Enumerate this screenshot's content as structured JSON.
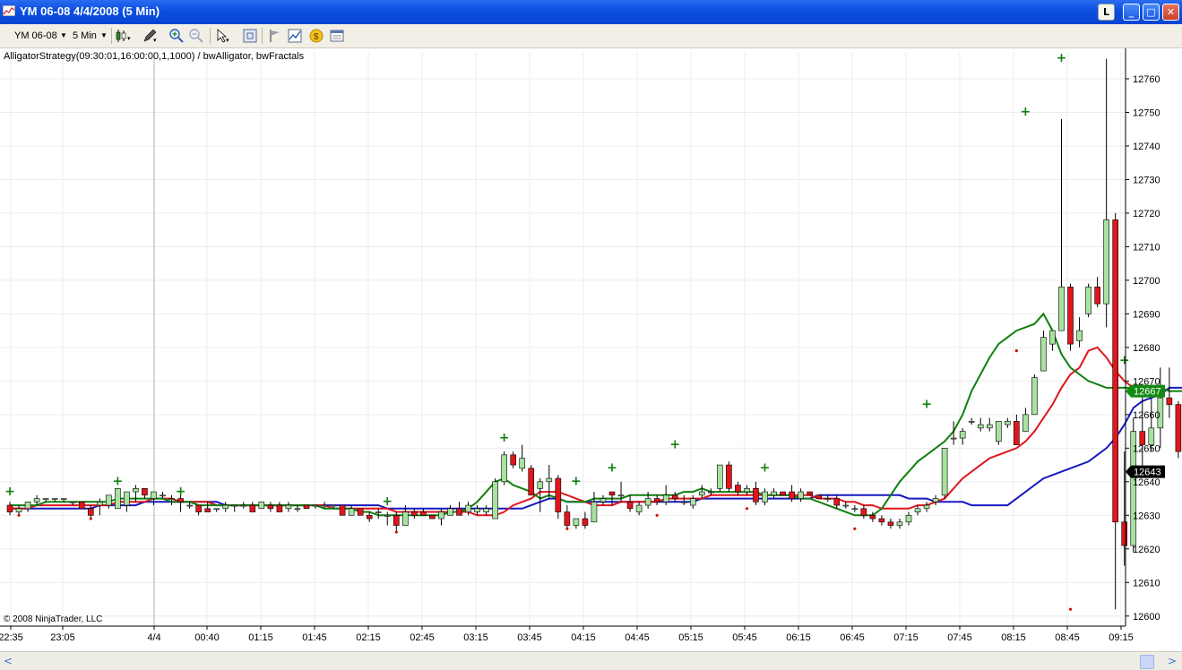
{
  "window": {
    "title": "YM 06-08  4/4/2008 (5 Min)",
    "buttons": {
      "light": "L",
      "minimize": "_",
      "maximize": "□",
      "close": "✕"
    }
  },
  "toolbar": {
    "instrument": "YM 06-08",
    "interval": "5 Min",
    "icons": [
      "candlestick-icon",
      "pencil-icon",
      "zoom-in-icon",
      "zoom-out-icon",
      "cursor-icon",
      "crosshair-icon",
      "flag-icon",
      "chart-icon",
      "strategy-icon",
      "data-box-icon"
    ]
  },
  "chart": {
    "strategy_label": "AlligatorStrategy(09:30:01,16:00:00,1,1000) / bwAlligator, bwFractals",
    "copyright": "© 2008 NinjaTrader, LLC",
    "last_price_label": "12643",
    "indicator_price_label": "12667",
    "colors": {
      "up": "#a8e2a0",
      "down": "#e0161c",
      "jaw": "#1818c0",
      "teeth": "#e0161c",
      "lips": "#108010",
      "fractal_up": "#108010",
      "fractal_down": "#d01010",
      "last_label_bg": "#000000",
      "ind_label_bg": "#128a12"
    }
  },
  "chart_data": {
    "type": "candlestick",
    "ylim": [
      12597,
      12768
    ],
    "y_ticks": [
      12600,
      12610,
      12620,
      12630,
      12640,
      12650,
      12660,
      12670,
      12680,
      12690,
      12700,
      12710,
      12720,
      12730,
      12740,
      12750,
      12760
    ],
    "x_labels": [
      "22:35",
      "23:05",
      "4/4",
      "00:40",
      "01:15",
      "01:45",
      "02:15",
      "02:45",
      "03:15",
      "03:45",
      "04:15",
      "04:45",
      "05:15",
      "05:45",
      "06:15",
      "06:45",
      "07:15",
      "07:45",
      "08:15",
      "08:45",
      "09:15"
    ],
    "candles": [
      [
        12633,
        12634,
        12630,
        12631
      ],
      [
        12631,
        12633,
        12630,
        12632
      ],
      [
        12632,
        12634,
        12631,
        12634
      ],
      [
        12634,
        12636,
        12633,
        12635
      ],
      [
        12635,
        12635,
        12634,
        12635
      ],
      [
        12635,
        12635,
        12634,
        12635
      ],
      [
        12635,
        12635,
        12634,
        12635
      ],
      [
        12634,
        12634,
        12633,
        12634
      ],
      [
        12634,
        12634,
        12632,
        12632
      ],
      [
        12632,
        12633,
        12629,
        12630
      ],
      [
        12633,
        12635,
        12630,
        12634
      ],
      [
        12633,
        12636,
        12632,
        12636
      ],
      [
        12632,
        12638,
        12632,
        12638
      ],
      [
        12633,
        12635,
        12631,
        12637
      ],
      [
        12637,
        12639,
        12634,
        12638
      ],
      [
        12638,
        12638,
        12635,
        12636
      ],
      [
        12635,
        12637,
        12633,
        12637
      ],
      [
        12636,
        12637,
        12635,
        12636
      ],
      [
        12635,
        12636,
        12633,
        12635
      ],
      [
        12635,
        12636,
        12631,
        12634
      ],
      [
        12633,
        12634,
        12632,
        12633
      ],
      [
        12633,
        12633,
        12630,
        12631
      ],
      [
        12632,
        12634,
        12631,
        12631
      ],
      [
        12632,
        12632,
        12631,
        12632
      ],
      [
        12632,
        12634,
        12631,
        12633
      ],
      [
        12633,
        12633,
        12631,
        12633
      ],
      [
        12633,
        12634,
        12632,
        12633
      ],
      [
        12633,
        12634,
        12631,
        12631
      ],
      [
        12632,
        12634,
        12632,
        12634
      ],
      [
        12633,
        12634,
        12631,
        12632
      ],
      [
        12633,
        12634,
        12631,
        12631
      ],
      [
        12632,
        12634,
        12631,
        12633
      ],
      [
        12632,
        12633,
        12631,
        12632
      ],
      [
        12633,
        12633,
        12632,
        12632
      ],
      [
        12633,
        12633,
        12632,
        12633
      ],
      [
        12633,
        12634,
        12632,
        12633
      ],
      [
        12633,
        12633,
        12632,
        12633
      ],
      [
        12633,
        12633,
        12630,
        12630
      ],
      [
        12630,
        12633,
        12630,
        12632
      ],
      [
        12632,
        12632,
        12630,
        12630
      ],
      [
        12630,
        12631,
        12628,
        12629
      ],
      [
        12631,
        12632,
        12629,
        12631
      ],
      [
        12630,
        12631,
        12627,
        12630
      ],
      [
        12630,
        12631,
        12625,
        12627
      ],
      [
        12627,
        12633,
        12627,
        12631
      ],
      [
        12631,
        12632,
        12629,
        12630
      ],
      [
        12631,
        12632,
        12630,
        12630
      ],
      [
        12630,
        12630,
        12629,
        12629
      ],
      [
        12629,
        12632,
        12627,
        12631
      ],
      [
        12630,
        12633,
        12630,
        12632
      ],
      [
        12632,
        12634,
        12630,
        12630
      ],
      [
        12631,
        12634,
        12630,
        12633
      ],
      [
        12631,
        12633,
        12630,
        12632
      ],
      [
        12631,
        12633,
        12630,
        12632
      ],
      [
        12629,
        12641,
        12629,
        12640
      ],
      [
        12640,
        12649,
        12639,
        12648
      ],
      [
        12648,
        12649,
        12644,
        12645
      ],
      [
        12644,
        12651,
        12643,
        12647
      ],
      [
        12644,
        12645,
        12636,
        12636
      ],
      [
        12638,
        12641,
        12631,
        12640
      ],
      [
        12640,
        12645,
        12635,
        12641
      ],
      [
        12641,
        12642,
        12629,
        12631
      ],
      [
        12631,
        12633,
        12626,
        12627
      ],
      [
        12627,
        12629,
        12626,
        12629
      ],
      [
        12629,
        12631,
        12626,
        12627
      ],
      [
        12628,
        12637,
        12628,
        12634
      ],
      [
        12634,
        12636,
        12633,
        12635
      ],
      [
        12637,
        12637,
        12633,
        12636
      ],
      [
        12636,
        12640,
        12634,
        12636
      ],
      [
        12634,
        12636,
        12631,
        12632
      ],
      [
        12631,
        12634,
        12630,
        12633
      ],
      [
        12633,
        12637,
        12632,
        12635
      ],
      [
        12635,
        12636,
        12633,
        12634
      ],
      [
        12634,
        12639,
        12633,
        12636
      ],
      [
        12636,
        12637,
        12634,
        12635
      ],
      [
        12634,
        12636,
        12633,
        12634
      ],
      [
        12633,
        12636,
        12632,
        12635
      ],
      [
        12636,
        12639,
        12635,
        12637
      ],
      [
        12637,
        12638,
        12636,
        12637
      ],
      [
        12638,
        12645,
        12637,
        12645
      ],
      [
        12645,
        12646,
        12637,
        12638
      ],
      [
        12639,
        12640,
        12636,
        12637
      ],
      [
        12637,
        12639,
        12636,
        12638
      ],
      [
        12638,
        12640,
        12633,
        12634
      ],
      [
        12634,
        12638,
        12633,
        12637
      ],
      [
        12636,
        12638,
        12635,
        12637
      ],
      [
        12637,
        12637,
        12636,
        12636
      ],
      [
        12637,
        12639,
        12634,
        12635
      ],
      [
        12635,
        12638,
        12634,
        12637
      ],
      [
        12637,
        12637,
        12636,
        12636
      ],
      [
        12636,
        12636,
        12635,
        12635
      ],
      [
        12635,
        12636,
        12634,
        12635
      ],
      [
        12635,
        12636,
        12632,
        12633
      ],
      [
        12633,
        12634,
        12632,
        12633
      ],
      [
        12632,
        12633,
        12631,
        12632
      ],
      [
        12632,
        12633,
        12629,
        12630
      ],
      [
        12630,
        12631,
        12628,
        12629
      ],
      [
        12629,
        12630,
        12627,
        12628
      ],
      [
        12628,
        12629,
        12626,
        12627
      ],
      [
        12627,
        12629,
        12626,
        12628
      ],
      [
        12628,
        12631,
        12627,
        12630
      ],
      [
        12631,
        12633,
        12630,
        12632
      ],
      [
        12632,
        12634,
        12631,
        12633
      ],
      [
        12634,
        12636,
        12633,
        12635
      ],
      [
        12636,
        12650,
        12635,
        12650
      ],
      [
        12653,
        12658,
        12651,
        12653
      ],
      [
        12653,
        12656,
        12651,
        12655
      ],
      [
        12658,
        12659,
        12657,
        12658
      ],
      [
        12656,
        12659,
        12655,
        12657
      ],
      [
        12656,
        12659,
        12655,
        12657
      ],
      [
        12652,
        12658,
        12651,
        12658
      ],
      [
        12657,
        12659,
        12656,
        12658
      ],
      [
        12658,
        12660,
        12651,
        12651
      ],
      [
        12655,
        12662,
        12655,
        12660
      ],
      [
        12660,
        12672,
        12660,
        12671
      ],
      [
        12673,
        12685,
        12673,
        12683
      ],
      [
        12681,
        12685,
        12679,
        12685
      ],
      [
        12685,
        12748,
        12685,
        12698
      ],
      [
        12698,
        12699,
        12679,
        12681
      ],
      [
        12682,
        12689,
        12680,
        12685
      ],
      [
        12690,
        12699,
        12689,
        12698
      ],
      [
        12698,
        12701,
        12692,
        12693
      ],
      [
        12693,
        12766,
        12686,
        12718
      ],
      [
        12718,
        12720,
        12602,
        12628
      ],
      [
        12628,
        12649,
        12615,
        12621
      ],
      [
        12621,
        12659,
        12619,
        12655
      ],
      [
        12655,
        12667,
        12644,
        12651
      ],
      [
        12651,
        12665,
        12649,
        12656
      ],
      [
        12656,
        12674,
        12650,
        12665
      ],
      [
        12665,
        12674,
        12659,
        12663
      ],
      [
        12663,
        12664,
        12647,
        12649
      ],
      [
        12649,
        12653,
        12641,
        12643
      ],
      [
        12641,
        12644,
        12640,
        12643
      ]
    ],
    "jaw": [
      12632,
      12632,
      12632,
      12632,
      12632,
      12632,
      12632,
      12632,
      12632,
      12632,
      12633,
      12633,
      12633,
      12633,
      12633,
      12634,
      12634,
      12634,
      12634,
      12634,
      12634,
      12634,
      12634,
      12634,
      12633,
      12633,
      12633,
      12633,
      12633,
      12633,
      12633,
      12633,
      12633,
      12633,
      12633,
      12633,
      12633,
      12633,
      12633,
      12633,
      12633,
      12633,
      12632,
      12632,
      12632,
      12632,
      12632,
      12632,
      12632,
      12632,
      12632,
      12632,
      12632,
      12632,
      12632,
      12632,
      12632,
      12632,
      12633,
      12634,
      12635,
      12635,
      12634,
      12634,
      12634,
      12634,
      12634,
      12634,
      12634,
      12634,
      12634,
      12634,
      12634,
      12634,
      12634,
      12634,
      12634,
      12635,
      12635,
      12635,
      12635,
      12635,
      12635,
      12635,
      12635,
      12635,
      12635,
      12635,
      12635,
      12635,
      12636,
      12636,
      12636,
      12636,
      12636,
      12636,
      12636,
      12636,
      12636,
      12636,
      12635,
      12635,
      12635,
      12634,
      12634,
      12634,
      12634,
      12633,
      12633,
      12633,
      12633,
      12633,
      12635,
      12637,
      12639,
      12641,
      12642,
      12643,
      12644,
      12645,
      12646,
      12648,
      12650,
      12653,
      12657,
      12662,
      12664,
      12665,
      12666,
      12668,
      12668,
      12668
    ],
    "teeth": [
      12632,
      12632,
      12632,
      12633,
      12633,
      12633,
      12633,
      12633,
      12633,
      12633,
      12633,
      12633,
      12634,
      12634,
      12634,
      12634,
      12635,
      12635,
      12635,
      12634,
      12634,
      12634,
      12634,
      12633,
      12633,
      12633,
      12633,
      12633,
      12633,
      12633,
      12633,
      12633,
      12633,
      12633,
      12633,
      12633,
      12632,
      12632,
      12632,
      12632,
      12632,
      12632,
      12632,
      12631,
      12631,
      12631,
      12631,
      12631,
      12631,
      12631,
      12631,
      12631,
      12630,
      12630,
      12630,
      12631,
      12633,
      12634,
      12635,
      12637,
      12637,
      12637,
      12636,
      12635,
      12634,
      12633,
      12633,
      12633,
      12634,
      12634,
      12634,
      12634,
      12634,
      12635,
      12635,
      12635,
      12635,
      12635,
      12636,
      12636,
      12636,
      12636,
      12636,
      12636,
      12636,
      12636,
      12636,
      12636,
      12636,
      12636,
      12635,
      12635,
      12635,
      12634,
      12634,
      12633,
      12633,
      12632,
      12632,
      12632,
      12632,
      12633,
      12633,
      12634,
      12635,
      12638,
      12641,
      12643,
      12645,
      12647,
      12648,
      12649,
      12650,
      12652,
      12655,
      12659,
      12663,
      12668,
      12672,
      12674,
      12679,
      12680,
      12677,
      12673,
      12670,
      12668,
      12668,
      12667
    ],
    "lips": [
      12633,
      12633,
      12633,
      12633,
      12634,
      12634,
      12634,
      12634,
      12634,
      12634,
      12634,
      12634,
      12635,
      12635,
      12635,
      12635,
      12635,
      12635,
      12634,
      12634,
      12634,
      12633,
      12633,
      12633,
      12633,
      12633,
      12633,
      12633,
      12633,
      12633,
      12633,
      12633,
      12633,
      12633,
      12633,
      12632,
      12632,
      12632,
      12632,
      12631,
      12631,
      12630,
      12630,
      12630,
      12630,
      12630,
      12630,
      12630,
      12630,
      12631,
      12631,
      12632,
      12634,
      12637,
      12640,
      12641,
      12639,
      12638,
      12637,
      12635,
      12636,
      12635,
      12634,
      12634,
      12634,
      12635,
      12635,
      12635,
      12635,
      12636,
      12636,
      12636,
      12636,
      12636,
      12636,
      12637,
      12637,
      12638,
      12637,
      12637,
      12637,
      12637,
      12637,
      12637,
      12636,
      12636,
      12636,
      12636,
      12635,
      12635,
      12634,
      12633,
      12632,
      12631,
      12630,
      12630,
      12630,
      12632,
      12636,
      12640,
      12643,
      12646,
      12648,
      12650,
      12652,
      12655,
      12660,
      12667,
      12672,
      12677,
      12681,
      12683,
      12685,
      12686,
      12687,
      12690,
      12685,
      12678,
      12674,
      12672,
      12670,
      12669,
      12668,
      12668,
      12668,
      12668,
      12668,
      12668,
      12668,
      12667,
      12667,
      12667
    ],
    "fractals_up": [
      [
        0,
        12636
      ],
      [
        12,
        12639
      ],
      [
        19,
        12636
      ],
      [
        42,
        12633
      ],
      [
        55,
        12652
      ],
      [
        63,
        12639
      ],
      [
        67,
        12643
      ],
      [
        74,
        12650
      ],
      [
        84,
        12643
      ],
      [
        102,
        12662
      ],
      [
        113,
        12749
      ],
      [
        117,
        12765
      ],
      [
        124,
        12675
      ]
    ],
    "fractals_down": [
      [
        1,
        12630
      ],
      [
        9,
        12629
      ],
      [
        43,
        12625
      ],
      [
        62,
        12626
      ],
      [
        72,
        12630
      ],
      [
        82,
        12632
      ],
      [
        94,
        12626
      ],
      [
        112,
        12679
      ],
      [
        118,
        12602
      ]
    ]
  }
}
